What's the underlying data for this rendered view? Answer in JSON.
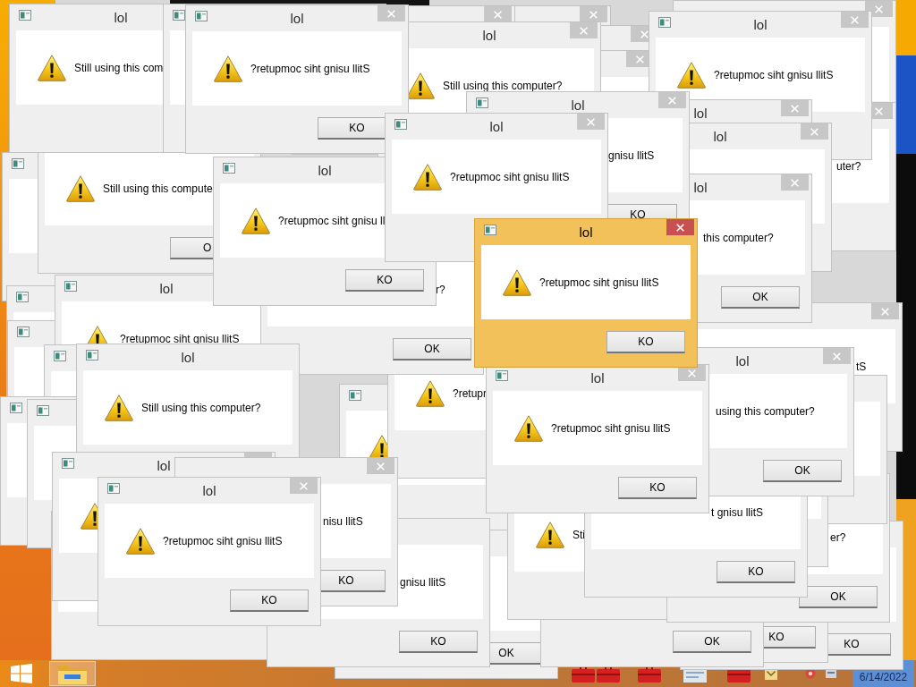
{
  "windows": [
    {
      "active": false
    },
    {
      "title": "lol",
      "message": "Still using this com",
      "active": false
    },
    {
      "active": false
    },
    {
      "title": "lol",
      "message": "?retupmoc siht gnisu llitS",
      "button": "KO",
      "active": false
    },
    {
      "active": false
    },
    {
      "active": false
    },
    {
      "title": "lol",
      "message": "Still using this computer?",
      "active": false
    },
    {
      "active": false
    },
    {
      "active": false
    },
    {
      "title": "lol",
      "message": "gnisu llitS",
      "button": "KO",
      "active": false
    },
    {
      "title": "lol",
      "message": "?retupmoc siht gnisu llitS",
      "active": false
    },
    {
      "message": "Still using this compute",
      "button": "O",
      "active": false
    },
    {
      "active": false
    },
    {
      "title": "lol",
      "message": "?retupmoc siht gnisu ll",
      "button": "KO",
      "active": false
    },
    {
      "title": "lol",
      "message": "?retupmoc siht gnisu llitS",
      "active": false
    },
    {
      "title": "lol",
      "active": false
    },
    {
      "message": "uter?",
      "active": false
    },
    {
      "title": "lol",
      "active": false
    },
    {
      "title": "lol",
      "message": "this computer?",
      "button": "OK",
      "active": false
    },
    {
      "title": "lol",
      "message": "?retupmoc siht gnisu llitS",
      "active": false
    },
    {
      "message": "r?",
      "button": "OK",
      "active": false
    },
    {
      "title": "lol",
      "message": "?retupmoc siht gnisu llitS",
      "button": "KO",
      "active": true
    },
    {
      "active": false
    },
    {
      "message": "tS",
      "active": false
    },
    {
      "active": false
    },
    {
      "message": "?retupr",
      "active": false
    },
    {
      "title": "lol",
      "message": "Still using this computer?",
      "active": false
    },
    {
      "active": false
    },
    {
      "title": "lol",
      "message": "using this computer?",
      "button": "OK",
      "active": false
    },
    {
      "title": "lol",
      "message": "?retupmoc siht gnisu llitS",
      "button": "KO",
      "active": false
    },
    {
      "active": false
    },
    {
      "active": false
    },
    {
      "active": false
    },
    {
      "active": false
    },
    {
      "active": false
    },
    {
      "message": "t gnisu llitS",
      "button": "KO",
      "active": false
    },
    {
      "title": "lol",
      "active": false
    },
    {
      "message": "nisu llitS",
      "button": "KO",
      "active": false
    },
    {
      "title": "lol",
      "message": "?retupmoc siht gnisu llitS",
      "button": "KO",
      "active": false
    },
    {
      "active": false
    },
    {
      "message": "gnisu llitS",
      "button": "KO",
      "active": false
    },
    {
      "button": "OK",
      "active": false
    },
    {
      "message": "Sti",
      "active": false
    },
    {
      "message": "er?",
      "button": "OK",
      "active": false
    },
    {
      "button": "KO",
      "active": false
    },
    {
      "button": "OK",
      "active": false
    },
    {
      "button": "KO",
      "active": false
    }
  ],
  "taskbar": {
    "clock": "6/14/2022"
  }
}
